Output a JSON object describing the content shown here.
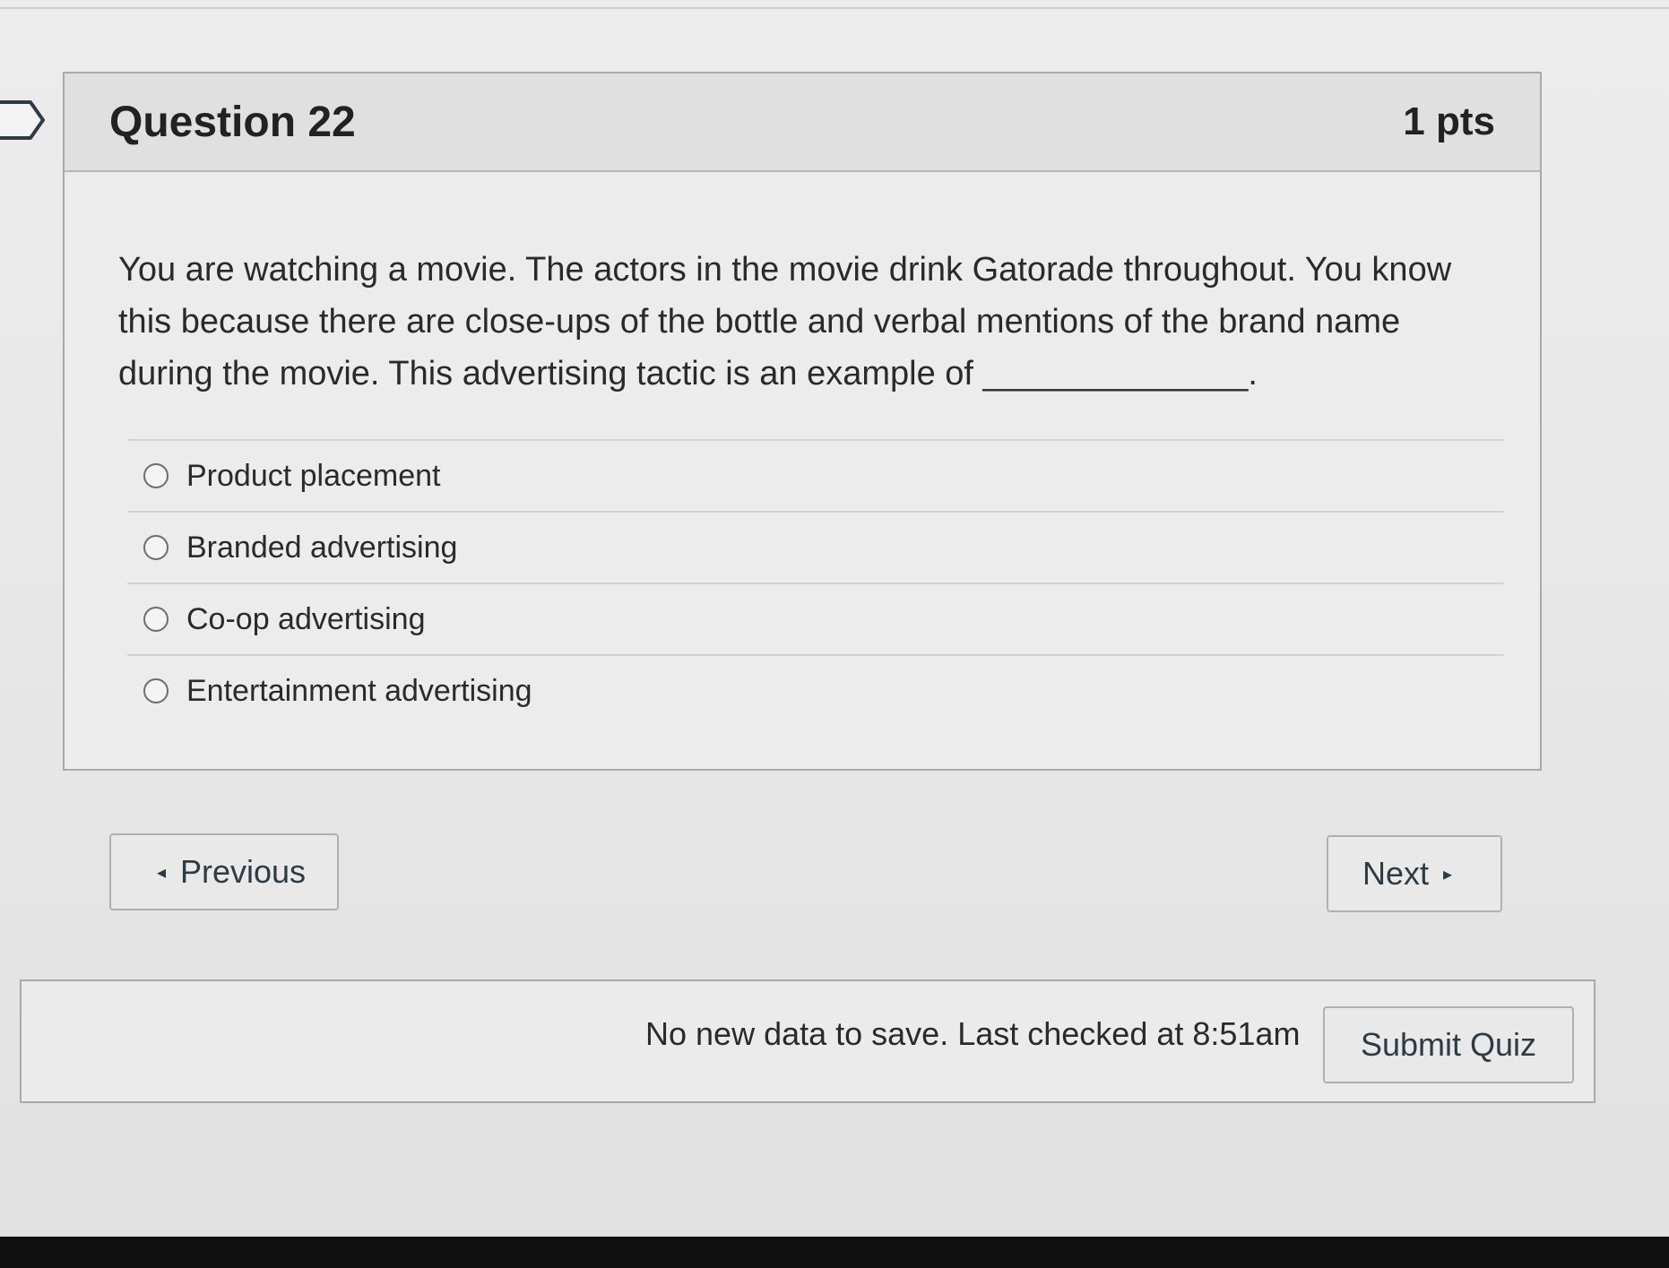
{
  "question": {
    "title": "Question 22",
    "points": "1 pts",
    "text": "You are watching a movie. The actors in the movie drink Gatorade throughout. You know this because there are close-ups of the bottle and verbal mentions of the brand name during the movie. This advertising tactic is an example of ______________.",
    "answers": [
      {
        "label": "Product placement"
      },
      {
        "label": "Branded advertising"
      },
      {
        "label": "Co-op advertising"
      },
      {
        "label": "Entertainment advertising"
      }
    ]
  },
  "nav": {
    "previous_label": "Previous",
    "next_label": "Next",
    "prev_icon": "caret-left-icon",
    "next_icon": "caret-right-icon"
  },
  "footer": {
    "status": "No new data to save. Last checked at 8:51am",
    "submit_label": "Submit Quiz"
  },
  "icons": {
    "flag": "flag-icon"
  }
}
